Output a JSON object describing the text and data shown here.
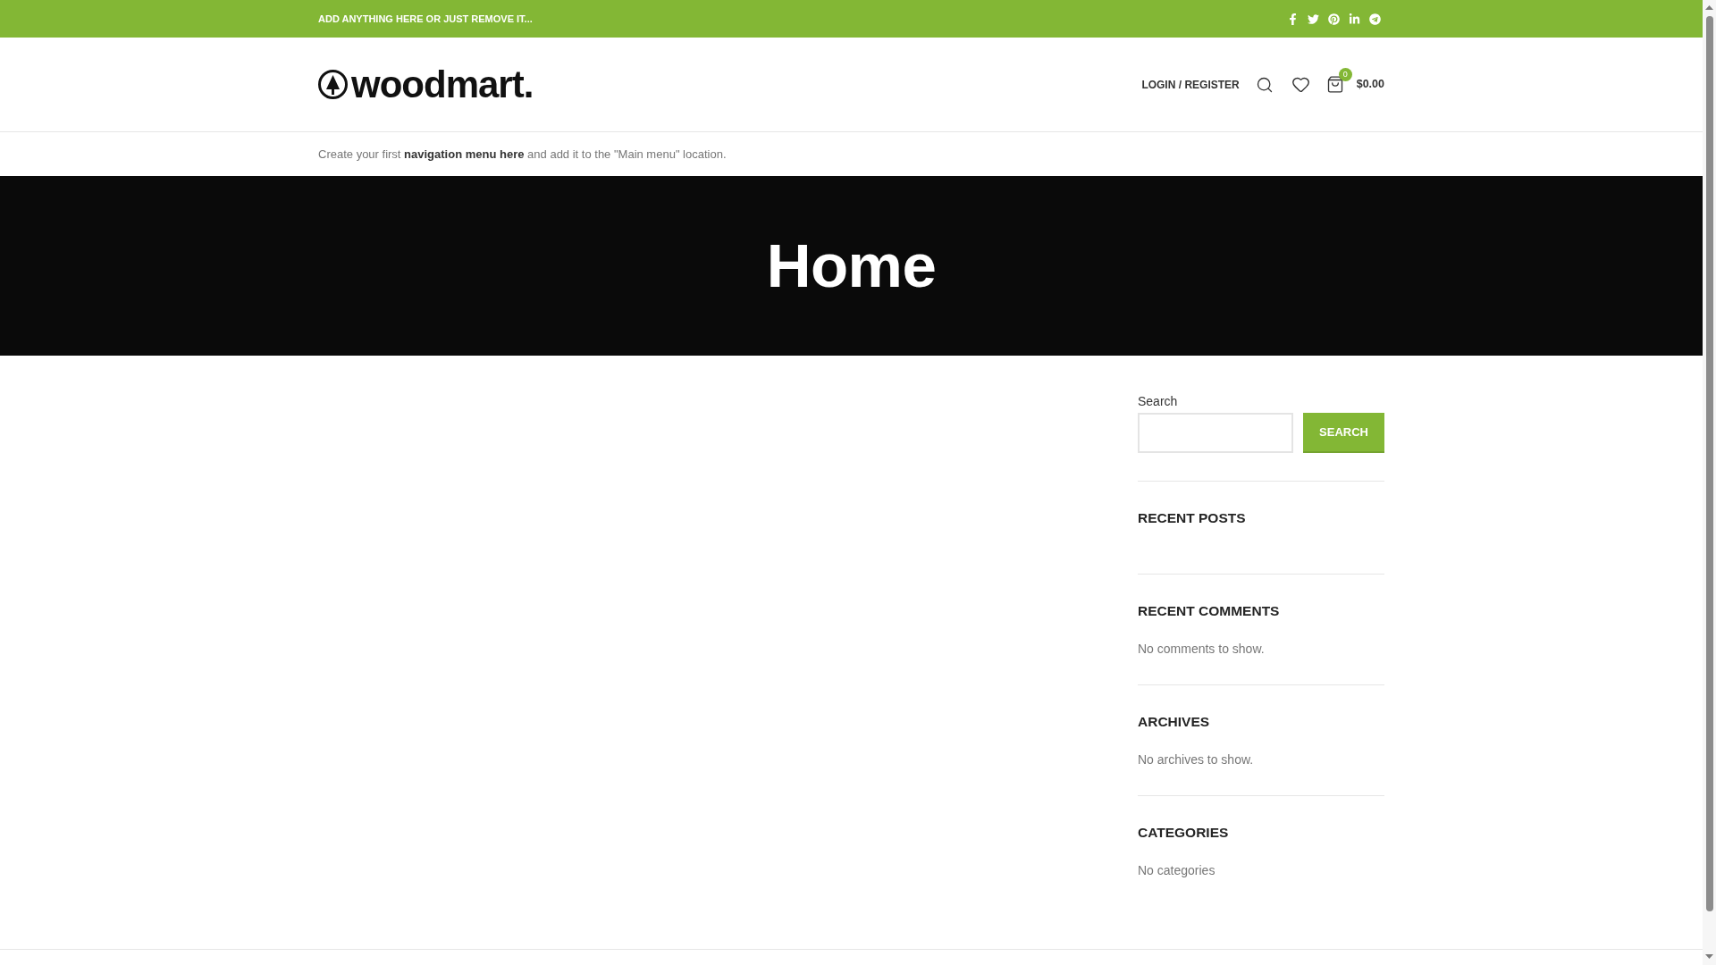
{
  "top_bar": {
    "text": "ADD ANYTHING HERE OR JUST REMOVE IT..."
  },
  "header": {
    "logo": "woodmart.",
    "login_link": "LOGIN / REGISTER",
    "cart": {
      "count": "0",
      "total": "$0.00"
    }
  },
  "nav_notice": {
    "before": "Create your first",
    "link": "navigation menu here",
    "after": "and add it to the \"Main menu\" location."
  },
  "hero": {
    "title": "Home"
  },
  "sidebar": {
    "search": {
      "label": "Search",
      "button": "SEARCH"
    },
    "widgets": [
      {
        "title": "RECENT POSTS"
      },
      {
        "title": "RECENT COMMENTS",
        "text": "No comments to show."
      },
      {
        "title": "ARCHIVES",
        "text": "No archives to show."
      },
      {
        "title": "CATEGORIES",
        "text": "No categories"
      }
    ]
  }
}
